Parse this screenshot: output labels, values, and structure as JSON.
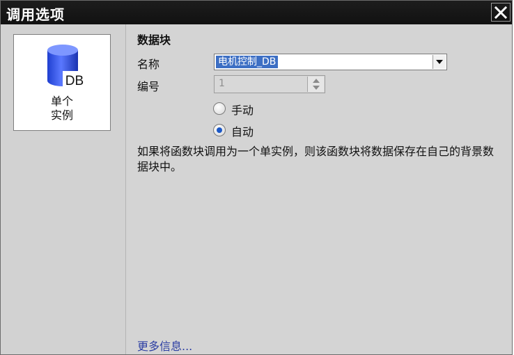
{
  "window": {
    "title": "调用选项"
  },
  "sidebar": {
    "option_label_line1": "单个",
    "option_label_line2": "实例",
    "icon_text": "DB"
  },
  "main": {
    "section_title": "数据块",
    "name_label": "名称",
    "name_value": "电机控制_DB",
    "number_label": "编号",
    "number_value": "1",
    "radio_manual": "手动",
    "radio_auto": "自动",
    "selected_radio": "自动",
    "description": "如果将函数块调用为一个单实例，则该函数块将数据保存在自己的背景数据块中。",
    "more_info": "更多信息..."
  },
  "colors": {
    "accent": "#3d6fc4",
    "radio_selected": "#1c58c6",
    "link": "#2d3fa3",
    "titlebar": "#1a1a1a"
  }
}
